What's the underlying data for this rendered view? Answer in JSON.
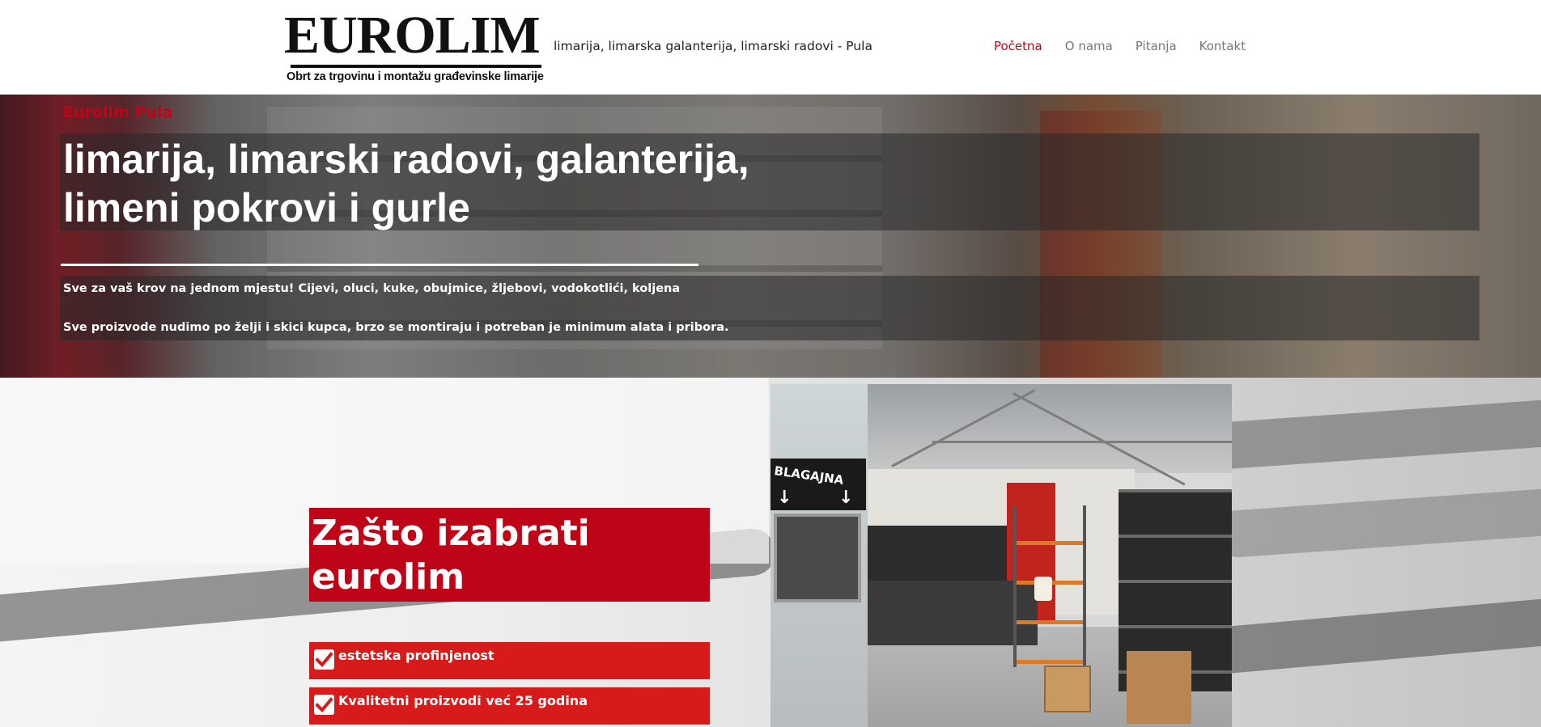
{
  "header": {
    "logo_word": "EUROLIM",
    "logo_subtitle": "Obrt za trgovinu i montažu građevinske limarije",
    "tagline": "limarija, limarska galanterija, limarski radovi - Pula",
    "nav": [
      {
        "label": "Početna",
        "active": true
      },
      {
        "label": "O nama",
        "active": false
      },
      {
        "label": "Pitanja",
        "active": false
      },
      {
        "label": "Kontakt",
        "active": false
      }
    ]
  },
  "hero": {
    "kicker": "Eurolim Pula",
    "title_line1": "limarija, limarski radovi, galanterija,",
    "title_line2": "limeni pokrovi i gurle",
    "text1": "Sve za vaš krov na jednom mjestu! Cijevi, oluci, kuke, obujmice, žljebovi, vodokotlići, koljena",
    "text2": "Sve proizvode nudimo po želji i skici kupca, brzo se montiraju i potreban je minimum alata i pribora."
  },
  "why": {
    "title_line1": "Zašto izabrati",
    "title_line2": "eurolim",
    "features": [
      {
        "label": "estetska profinjenost",
        "icon": "check-icon"
      },
      {
        "label": "Kvalitetni proizvodi već 25 godina",
        "icon": "check-icon"
      }
    ]
  },
  "photo": {
    "sign_text": "BLAGAJNA",
    "sign_arrows": [
      "↓",
      "↓"
    ]
  },
  "colors": {
    "brand_red": "#c00418",
    "feature_red": "#d71a1a",
    "nav_gray": "#777777"
  }
}
